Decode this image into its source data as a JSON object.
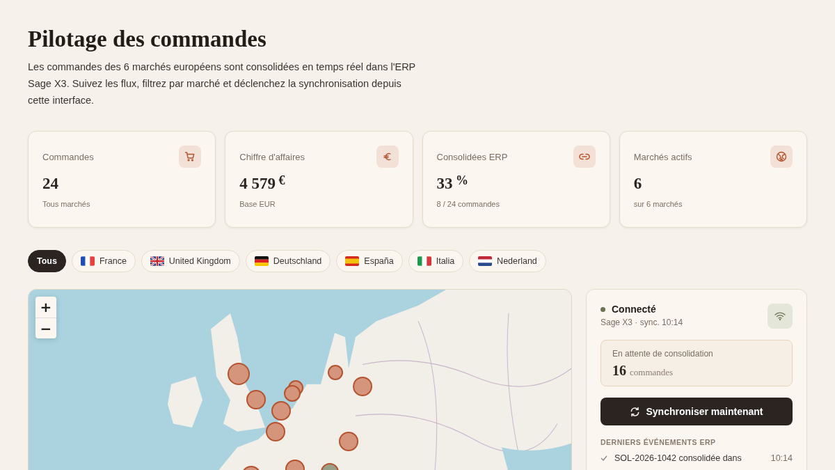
{
  "title": "Pilotage des commandes",
  "description": "Les commandes des 6 marchés européens sont consolidées en temps réel dans l'ERP Sage X3. Suivez les flux, filtrez par marché et déclenchez la synchronisation depuis cette interface.",
  "stats": [
    {
      "label": "Commandes",
      "value": "24",
      "sub": "Tous marchés"
    },
    {
      "label": "Chiffre d'affaires",
      "value": "4 579",
      "unit": "€",
      "sub": "Base EUR"
    },
    {
      "label": "Consolidées ERP",
      "value": "33",
      "unit": "%",
      "sub": "8 / 24 commandes"
    },
    {
      "label": "Marchés actifs",
      "value": "6",
      "sub": "sur 6 marchés"
    }
  ],
  "markets": [
    {
      "label": "Tous",
      "selected": true
    },
    {
      "label": "France",
      "selected": false
    },
    {
      "label": "United Kingdom",
      "selected": false
    },
    {
      "label": "Deutschland",
      "selected": false
    },
    {
      "label": "España",
      "selected": false
    },
    {
      "label": "Italia",
      "selected": false
    },
    {
      "label": "Nederland",
      "selected": false
    }
  ],
  "map": {
    "zoom_in": "+",
    "zoom_out": "−",
    "markers": [
      {
        "color": "#d4957c"
      },
      {
        "color": "#d4957c"
      },
      {
        "color": "#d4957c"
      },
      {
        "color": "#d4957c"
      },
      {
        "color": "#d4957c"
      },
      {
        "color": "#d4957c"
      },
      {
        "color": "#d4957c"
      },
      {
        "color": "#d4957c"
      },
      {
        "color": "#d4957c"
      },
      {
        "color": "#d4957c"
      },
      {
        "color": "#d4957c"
      },
      {
        "color": "#9aa088"
      }
    ]
  },
  "erp": {
    "status": "Connecté",
    "connected": true,
    "subtitle": "Sage X3 · sync. 10:14",
    "pending_label": "En attente de consolidation",
    "pending_count": "16",
    "pending_unit": "commandes",
    "sync_button": "Synchroniser maintenant",
    "events_heading": "DERNIERS ÉVÉNEMENTS ERP",
    "events": [
      {
        "text": "SOL-2026-1042 consolidée dans",
        "time": "10:14"
      }
    ]
  }
}
